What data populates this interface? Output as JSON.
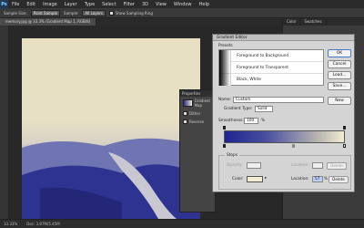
{
  "app": {
    "logo": "Ps"
  },
  "menu": [
    "File",
    "Edit",
    "Image",
    "Layer",
    "Type",
    "Select",
    "Filter",
    "3D",
    "View",
    "Window",
    "Help"
  ],
  "options": {
    "sample_size_label": "Sample Size:",
    "sample_size_value": "Point Sample",
    "sample_label": "Sample:",
    "sample_value": "All Layers",
    "ring_label": "Show Sampling Ring"
  },
  "document_tab": "memory.jpg @ 33.3% (Gradient Map 1, RGB/8)",
  "right_tabs": [
    "Color",
    "Swatches"
  ],
  "properties": {
    "title": "Properties",
    "layer": "Gradient Map",
    "dither": "Dither",
    "reverse": "Reverse"
  },
  "status": {
    "zoom": "33.33%",
    "doc": "Doc: 3.87M/5.45M"
  },
  "dialog": {
    "title": "Gradient Editor",
    "presets_label": "Presets",
    "presets": [
      "Foreground to Background",
      "Foreground to Transparent",
      "Black, White"
    ],
    "buttons": {
      "ok": "OK",
      "cancel": "Cancel",
      "load": "Load...",
      "save": "Save...",
      "new": "New"
    },
    "name_label": "Name:",
    "name_value": "Custom",
    "type_label": "Gradient Type:",
    "type_value": "Solid",
    "smooth_label": "Smoothness:",
    "smooth_value": "100",
    "smooth_unit": "%",
    "stops_label": "Stops",
    "opacity_label": "Opacity:",
    "location_label": "Location:",
    "location_value": "57",
    "delete_label": "Delete",
    "color_label": "Color:",
    "percent": "%"
  }
}
